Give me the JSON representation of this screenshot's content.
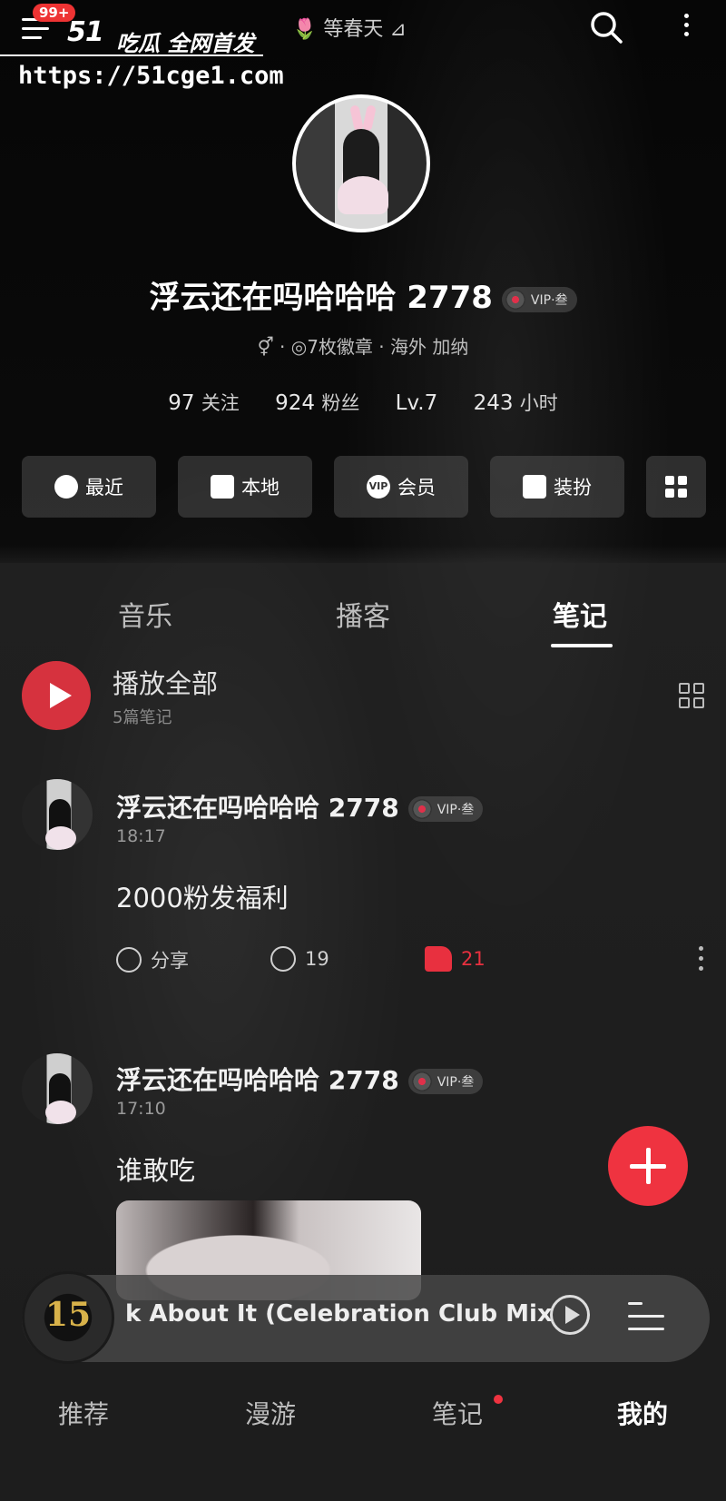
{
  "watermark": {
    "badge": "99+",
    "brand": "51",
    "slogan": "吃瓜 全网首发",
    "url": "https://51cge1.com"
  },
  "header": {
    "now_playing": "🌷 等春天 ⊿"
  },
  "profile": {
    "name": "浮云还在吗哈哈哈 2778",
    "vip": "VIP·叁",
    "meta": "⚥ · ◎7枚徽章 · 海外 加纳",
    "stats": [
      {
        "num": "97",
        "label": "关注"
      },
      {
        "num": "924",
        "label": "粉丝"
      },
      {
        "num": "Lv.7",
        "label": ""
      },
      {
        "num": "243",
        "label": "小时"
      }
    ]
  },
  "quick": [
    "最近",
    "本地",
    "会员",
    "装扮"
  ],
  "tabs": [
    "音乐",
    "播客",
    "笔记"
  ],
  "list": {
    "play_all": "播放全部",
    "count": "5篇笔记"
  },
  "posts": [
    {
      "name": "浮云还在吗哈哈哈 2778",
      "vip": "VIP·叁",
      "time": "18:17",
      "text": "2000粉发福利",
      "share": "分享",
      "comments": "19",
      "likes": "21"
    },
    {
      "name": "浮云还在吗哈哈哈 2778",
      "vip": "VIP·叁",
      "time": "17:10",
      "text": "谁敢吃"
    }
  ],
  "player": {
    "cover_text": "15",
    "song": "k About It (Celebration Club Mix)"
  },
  "nav": [
    "推荐",
    "漫游",
    "笔记",
    "我的"
  ],
  "colors": {
    "accent": "#ef3340",
    "vip": "#e0304a"
  }
}
